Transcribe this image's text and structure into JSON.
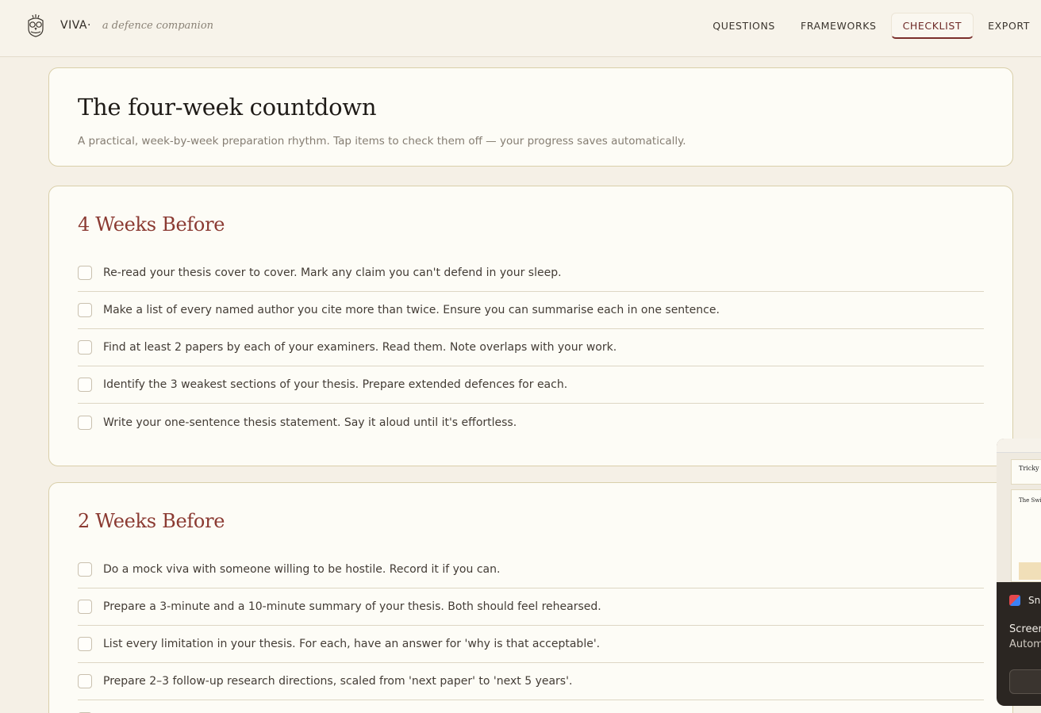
{
  "header": {
    "brand": "VIVA·",
    "tagline": "a defence companion",
    "nav": [
      {
        "label": "QUESTIONS",
        "active": false
      },
      {
        "label": "FRAMEWORKS",
        "active": false
      },
      {
        "label": "CHECKLIST",
        "active": true
      },
      {
        "label": "EXPORT",
        "active": false
      }
    ],
    "logo_icon": "owl-icon"
  },
  "intro": {
    "title": "The four-week countdown",
    "description": "A practical, week-by-week preparation rhythm. Tap items to check them off — your progress saves automatically."
  },
  "sections": [
    {
      "heading": "4 Weeks Before",
      "items": [
        "Re-read your thesis cover to cover. Mark any claim you can't defend in your sleep.",
        "Make a list of every named author you cite more than twice. Ensure you can summarise each in one sentence.",
        "Find at least 2 papers by each of your examiners. Read them. Note overlaps with your work.",
        "Identify the 3 weakest sections of your thesis. Prepare extended defences for each.",
        "Write your one-sentence thesis statement. Say it aloud until it's effortless."
      ]
    },
    {
      "heading": "2 Weeks Before",
      "items": [
        "Do a mock viva with someone willing to be hostile. Record it if you can.",
        "Prepare a 3-minute and a 10-minute summary of your thesis. Both should feel rehearsed.",
        "List every limitation in your thesis. For each, have an answer for 'why is that acceptable'.",
        "Prepare 2–3 follow-up research directions, scaled from 'next paper' to 'next 5 years'.",
        ""
      ]
    }
  ],
  "overlay": {
    "app_name": "Sni",
    "title": "Screen",
    "subtitle": "Autom",
    "preview_title": "Tricky",
    "preview_heading": "The Swi"
  },
  "colors": {
    "accent": "#8b3a32",
    "background": "#f5f0e6",
    "card": "#fdfcf6"
  }
}
